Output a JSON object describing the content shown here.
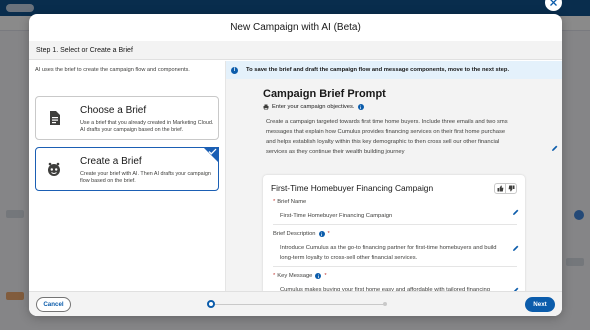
{
  "modal": {
    "title": "New Campaign with AI (Beta)",
    "step_label": "Step 1. Select or Create a Brief"
  },
  "left": {
    "intro": "AI uses the brief to create the campaign flow and components.",
    "cards": [
      {
        "title": "Choose a Brief",
        "description": "Use a brief that you already created in Marketing Cloud. AI drafts your campaign based on the brief.",
        "icon": "document-icon"
      },
      {
        "title": "Create a Brief",
        "description": "Create your brief with AI. Then AI drafts your campaign flow based on the brief.",
        "icon": "einstein-bot-icon"
      }
    ]
  },
  "right": {
    "banner": "To save the brief and draft the campaign flow and message components, move to the next step.",
    "prompt_title": "Campaign Brief Prompt",
    "prompt_subtitle": "Enter your campaign objectives.",
    "prompt_text": "Create a campaign targeted towards first time home buyers. Include three emails and two sms messages that explain how Cumulus provides financing services on their first home purchase and helps establish loyalty within this key demographic to then cross sell our other financial services as they continue their wealth building journey",
    "campaign": {
      "title": "First-Time Homebuyer Financing Campaign",
      "fields": [
        {
          "label": "Brief Name",
          "value": "First-Time Homebuyer Financing Campaign"
        },
        {
          "label": "Brief Description",
          "value": "Introduce Cumulus as the go-to financing partner for first-time homebuyers and build long-term loyalty to cross-sell other financial services."
        },
        {
          "label": "Key Message",
          "value": "Cumulus makes buying your first home easy and affordable with tailored financing options, guiding you through every step of the process."
        }
      ]
    }
  },
  "footer": {
    "cancel_label": "Cancel",
    "next_label": "Next",
    "progress_step": 1,
    "progress_total": 2
  },
  "colors": {
    "brand": "#0b5cab",
    "selected_border": "#1b5fb4",
    "banner_bg": "#e4f1fb",
    "required": "#c23934"
  }
}
